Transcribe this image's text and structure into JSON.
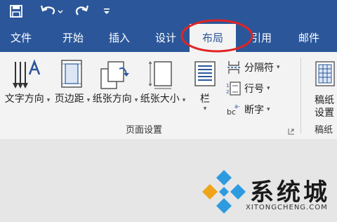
{
  "quick_access": {
    "save_icon": "save-icon",
    "undo_icon": "undo-icon",
    "redo_icon": "redo-icon",
    "customize_icon": "customize-icon"
  },
  "tabs": [
    {
      "label": "文件"
    },
    {
      "label": "开始"
    },
    {
      "label": "插入"
    },
    {
      "label": "设计"
    },
    {
      "label": "布局"
    },
    {
      "label": "引用"
    },
    {
      "label": "邮件"
    }
  ],
  "active_tab": "布局",
  "ribbon": {
    "buttons": {
      "text_direction": "文字方向",
      "margins": "页边距",
      "orientation": "纸张方向",
      "size": "纸张大小",
      "columns": "栏"
    },
    "small_buttons": {
      "breaks": "分隔符",
      "line_numbers": "行号",
      "hyphenation": "断字"
    },
    "group_label": "页面设置",
    "manuscript": {
      "line1": "稿纸",
      "line2": "设置",
      "group_label": "稿纸"
    }
  },
  "watermark": {
    "text": "系统城",
    "url": "XITONGCHENG.COM"
  },
  "colors": {
    "accent": "#2b579a",
    "annotation_circle": "#e02424",
    "ribbon_bg": "#f3f3f3"
  }
}
